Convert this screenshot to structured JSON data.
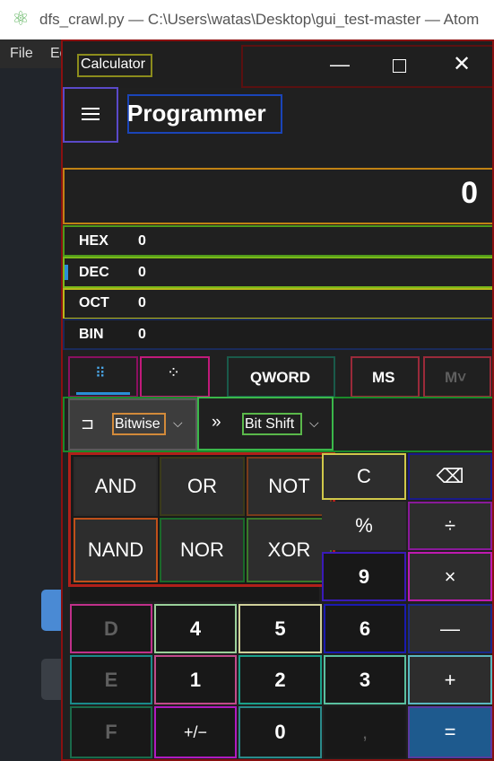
{
  "host": {
    "title": "dfs_crawl.py — C:\\Users\\watas\\Desktop\\gui_test-master — Atom",
    "menu": [
      "File",
      "Ed"
    ]
  },
  "calc": {
    "app_title": "Calculator",
    "mode": "Programmer",
    "display": "0",
    "radix": [
      {
        "label": "HEX",
        "value": "0"
      },
      {
        "label": "DEC",
        "value": "0"
      },
      {
        "label": "OCT",
        "value": "0"
      },
      {
        "label": "BIN",
        "value": "0"
      }
    ],
    "word_size": "QWORD",
    "ms": "MS",
    "mr": "M˅",
    "bitwise": "Bitwise",
    "bitshift": "Bit Shift",
    "logic": [
      "AND",
      "OR",
      "NOT",
      "NAND",
      "NOR",
      "XOR"
    ],
    "keys": {
      "clear": "C",
      "backspace": "⌫",
      "percent": "%",
      "divide": "÷",
      "nine": "9",
      "multiply": "×",
      "d": "D",
      "four": "4",
      "five": "5",
      "six": "6",
      "minus": "—",
      "e": "E",
      "one": "1",
      "two": "2",
      "three": "3",
      "plus": "+",
      "f": "F",
      "negate": "+/−",
      "zero": "0",
      "decimal": ",",
      "equals": "="
    },
    "colors": {
      "accent": "#1e5a8e",
      "indicator": "#2a8fd6"
    }
  }
}
